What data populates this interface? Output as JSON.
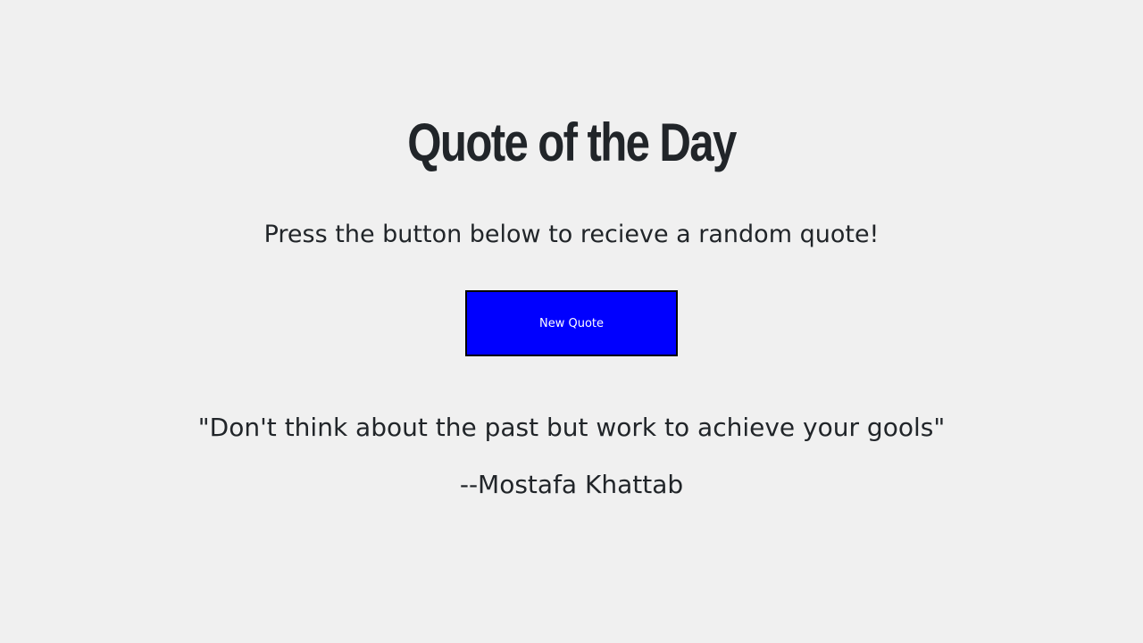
{
  "header": {
    "title": "Quote of the Day",
    "subtitle": "Press the button below to recieve a random quote!"
  },
  "actions": {
    "new_quote_label": "New Quote"
  },
  "quote": {
    "text": "\"Don't think about the past but work to achieve your gools\"",
    "author": "--Mostafa Khattab"
  },
  "colors": {
    "background": "#f0f0f0",
    "text": "#212529",
    "button_bg": "#0000ff",
    "button_text": "#ffffff",
    "button_border": "#000000"
  }
}
